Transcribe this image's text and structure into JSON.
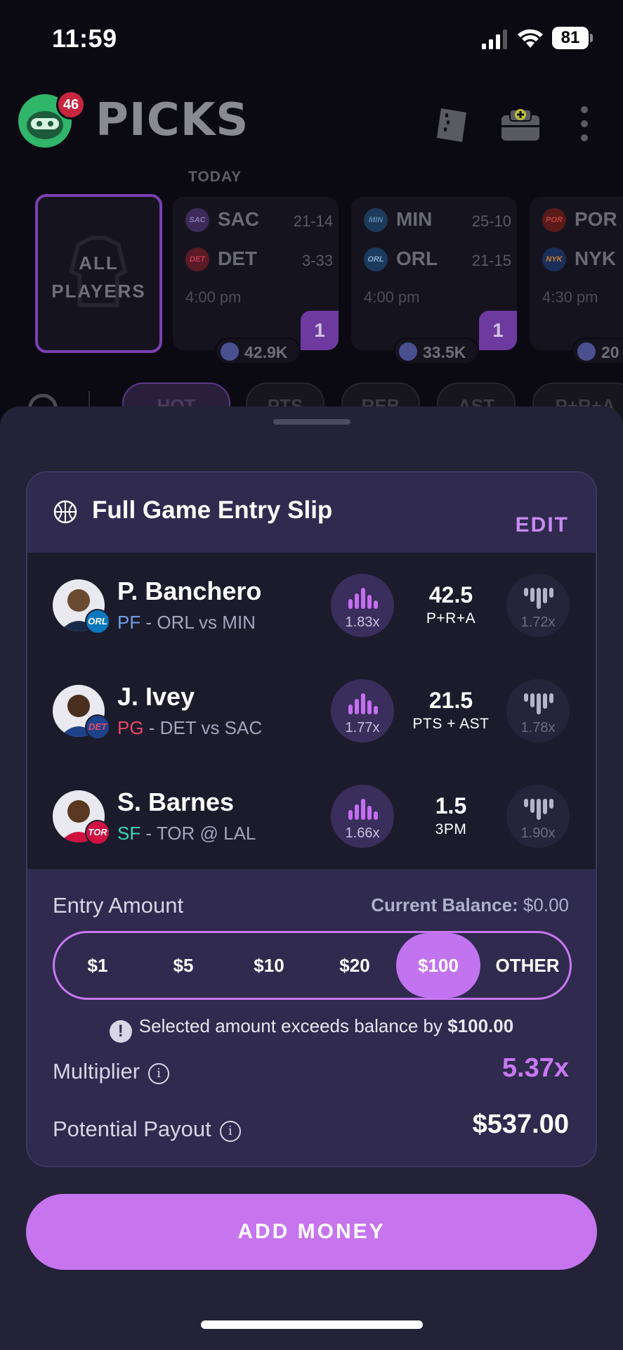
{
  "status_bar": {
    "time": "11:59",
    "battery": "81"
  },
  "header": {
    "title": "PICKS",
    "notification_count": "46"
  },
  "games": {
    "section_label": "TODAY",
    "all_players_line1": "ALL",
    "all_players_line2": "PLAYERS",
    "cards": [
      {
        "team1": "SAC",
        "team1_record": "21-14",
        "team2": "DET",
        "team2_record": "3-33",
        "time": "4:00 pm",
        "pick_count": "1",
        "users": "42.9K"
      },
      {
        "team1": "MIN",
        "team1_record": "25-10",
        "team2": "ORL",
        "team2_record": "21-15",
        "time": "4:00 pm",
        "pick_count": "1",
        "users": "33.5K"
      },
      {
        "team1": "POR",
        "team1_record": "",
        "team2": "NYK",
        "team2_record": "",
        "time": "4:30 pm",
        "pick_count": "",
        "users": "20"
      }
    ]
  },
  "filters": {
    "chips": [
      "HOT",
      "PTS",
      "REB",
      "AST",
      "P+R+A"
    ]
  },
  "slip": {
    "title": "Full Game Entry Slip",
    "edit_label": "EDIT",
    "players": [
      {
        "name": "P. Banchero",
        "position": "PF",
        "matchup": " - ORL vs MIN",
        "team_badge": "ORL",
        "line": "42.5",
        "stat": "P+R+A",
        "more_mult": "1.83x",
        "less_mult": "1.72x",
        "pos_color": "#6fa0e8",
        "badge_color": "#0b77bd"
      },
      {
        "name": "J. Ivey",
        "position": "PG",
        "matchup": " - DET vs SAC",
        "team_badge": "DET",
        "line": "21.5",
        "stat": "PTS + AST",
        "more_mult": "1.77x",
        "less_mult": "1.78x",
        "pos_color": "#e84a6a",
        "badge_color": "#1d428a"
      },
      {
        "name": "S. Barnes",
        "position": "SF",
        "matchup": " - TOR @ LAL",
        "team_badge": "TOR",
        "line": "1.5",
        "stat": "3PM",
        "more_mult": "1.66x",
        "less_mult": "1.90x",
        "pos_color": "#3fd6b0",
        "badge_color": "#ce1141"
      }
    ],
    "entry_label": "Entry Amount",
    "balance_label": "Current Balance:",
    "balance_value": " $0.00",
    "amounts": [
      "$1",
      "$5",
      "$10",
      "$20",
      "$100",
      "OTHER"
    ],
    "selected_amount": "$100",
    "warning_text": "Selected amount exceeds balance by ",
    "warning_amount": "$100.00",
    "multiplier_label": "Multiplier",
    "multiplier_value": "5.37x",
    "payout_label": "Potential Payout",
    "payout_value": "$537.00"
  },
  "cta": {
    "label": "ADD MONEY"
  },
  "colors": {
    "accent": "#c775ef",
    "sheet_bg": "#232237",
    "card_bg": "#302a4e"
  }
}
